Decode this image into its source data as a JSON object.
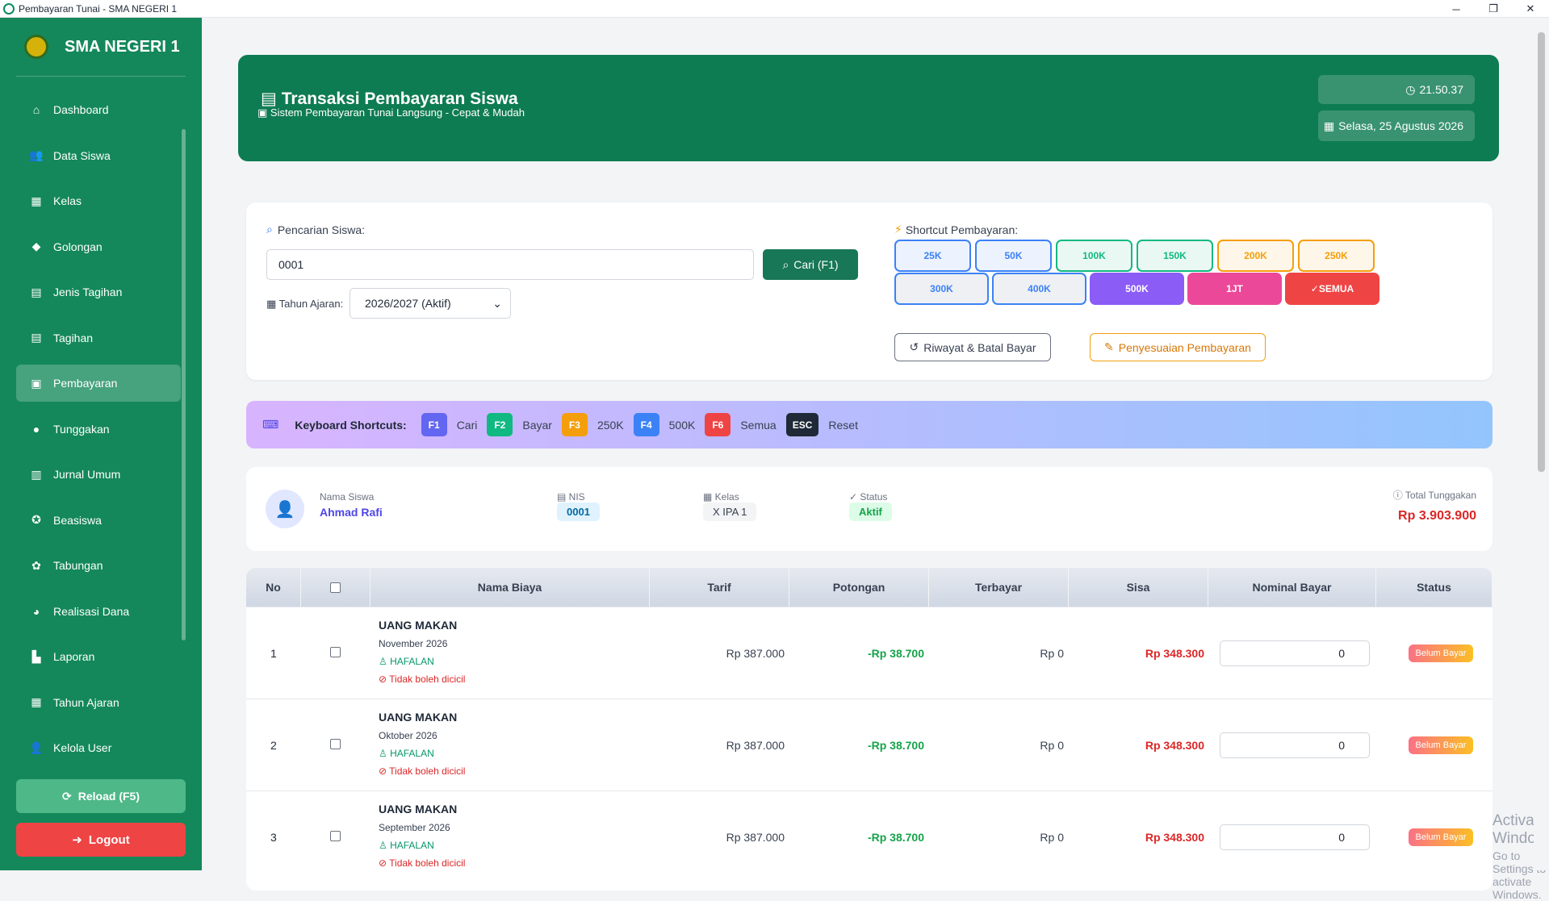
{
  "window": {
    "title": "Pembayaran Tunai - SMA NEGERI 1",
    "min": "─",
    "max": "❐",
    "close": "✕"
  },
  "sidebar": {
    "brand": "SMA NEGERI 1",
    "items": [
      {
        "label": "Dashboard",
        "icon": "home-icon",
        "glyph": "⌂"
      },
      {
        "label": "Data Siswa",
        "icon": "users-icon",
        "glyph": "👥"
      },
      {
        "label": "Kelas",
        "icon": "school-icon",
        "glyph": "▦"
      },
      {
        "label": "Golongan",
        "icon": "tag-icon",
        "glyph": "◆"
      },
      {
        "label": "Jenis Tagihan",
        "icon": "file-icon",
        "glyph": "▤"
      },
      {
        "label": "Tagihan",
        "icon": "invoice-icon",
        "glyph": "▤"
      },
      {
        "label": "Pembayaran",
        "icon": "money-icon",
        "glyph": "▣"
      },
      {
        "label": "Tunggakan",
        "icon": "clock-icon",
        "glyph": "●"
      },
      {
        "label": "Jurnal Umum",
        "icon": "book-icon",
        "glyph": "▥"
      },
      {
        "label": "Beasiswa",
        "icon": "award-icon",
        "glyph": "✪"
      },
      {
        "label": "Tabungan",
        "icon": "piggy-icon",
        "glyph": "✿"
      },
      {
        "label": "Realisasi Dana",
        "icon": "chart-pie-icon",
        "glyph": "◕"
      },
      {
        "label": "Laporan",
        "icon": "chart-line-icon",
        "glyph": "▙"
      },
      {
        "label": "Tahun Ajaran",
        "icon": "calendar-icon",
        "glyph": "▦"
      },
      {
        "label": "Kelola User",
        "icon": "user-cog-icon",
        "glyph": "👤"
      }
    ],
    "reload": "Reload (F5)",
    "logout": "Logout"
  },
  "header": {
    "title": "Transaksi Pembayaran Siswa",
    "subtitle": "Sistem Pembayaran Tunai Langsung - Cepat & Mudah",
    "time": "21.50.37",
    "date": "Selasa, 25 Agustus 2026"
  },
  "search": {
    "label": "Pencarian Siswa:",
    "value": "0001",
    "button": "Cari (F1)",
    "year_label": "Tahun Ajaran:",
    "year_value": "2026/2027 (Aktif)"
  },
  "shortcuts": {
    "title": "Shortcut Pembayaran:",
    "row1": [
      {
        "label": "25K",
        "color": "#3b82f6"
      },
      {
        "label": "50K",
        "color": "#3b82f6"
      },
      {
        "label": "100K",
        "color": "#10b981"
      },
      {
        "label": "150K",
        "color": "#10b981"
      },
      {
        "label": "200K",
        "color": "#f59e0b"
      },
      {
        "label": "250K",
        "color": "#f59e0b"
      }
    ],
    "row2": [
      {
        "label": "300K",
        "color": "#3b82f6"
      },
      {
        "label": "400K",
        "color": "#3b82f6"
      },
      {
        "label": "500K",
        "color": "#8b5cf6"
      },
      {
        "label": "1JT",
        "color": "#ec4899"
      },
      {
        "label": "SEMUA",
        "color": "#ef4444"
      }
    ],
    "history": "Riwayat & Batal Bayar",
    "adjust": "Penyesuaian Pembayaran"
  },
  "keyboard": {
    "title": "Keyboard Shortcuts:",
    "keys": [
      {
        "key": "F1",
        "label": "Cari",
        "color": "#6366f1"
      },
      {
        "key": "F2",
        "label": "Bayar",
        "color": "#10b981"
      },
      {
        "key": "F3",
        "label": "250K",
        "color": "#f59e0b"
      },
      {
        "key": "F4",
        "label": "500K",
        "color": "#3b82f6"
      },
      {
        "key": "F6",
        "label": "Semua",
        "color": "#ef4444"
      },
      {
        "key": "ESC",
        "label": "Reset",
        "color": "#1f2937"
      }
    ]
  },
  "student": {
    "name_label": "Nama Siswa",
    "name": "Ahmad Rafi",
    "nis_label": "NIS",
    "nis": "0001",
    "class_label": "Kelas",
    "class": "X IPA 1",
    "status_label": "Status",
    "status": "Aktif",
    "arrears_label": "Total Tunggakan",
    "arrears": "Rp 3.903.900"
  },
  "table": {
    "headers": [
      "No",
      "Nama Biaya",
      "Tarif",
      "Potongan",
      "Terbayar",
      "Sisa",
      "Nominal Bayar",
      "Status"
    ],
    "rows": [
      {
        "no": "1",
        "name": "UANG MAKAN",
        "month": "November 2026",
        "tag": "HAFALAN",
        "warn": "Tidak boleh dicicil",
        "tarif": "Rp 387.000",
        "potongan": "-Rp 38.700",
        "terbayar": "Rp 0",
        "sisa": "Rp 348.300",
        "nominal": "0",
        "status": "Belum Bayar"
      },
      {
        "no": "2",
        "name": "UANG MAKAN",
        "month": "Oktober 2026",
        "tag": "HAFALAN",
        "warn": "Tidak boleh dicicil",
        "tarif": "Rp 387.000",
        "potongan": "-Rp 38.700",
        "terbayar": "Rp 0",
        "sisa": "Rp 348.300",
        "nominal": "0",
        "status": "Belum Bayar"
      },
      {
        "no": "3",
        "name": "UANG MAKAN",
        "month": "September 2026",
        "tag": "HAFALAN",
        "warn": "Tidak boleh dicicil",
        "tarif": "Rp 387.000",
        "potongan": "-Rp 38.700",
        "terbayar": "Rp 0",
        "sisa": "Rp 348.300",
        "nominal": "0",
        "status": "Belum Bayar"
      }
    ]
  },
  "watermark": {
    "line1": "Activate Windows",
    "line2": "Go to Settings to activate Windows."
  }
}
